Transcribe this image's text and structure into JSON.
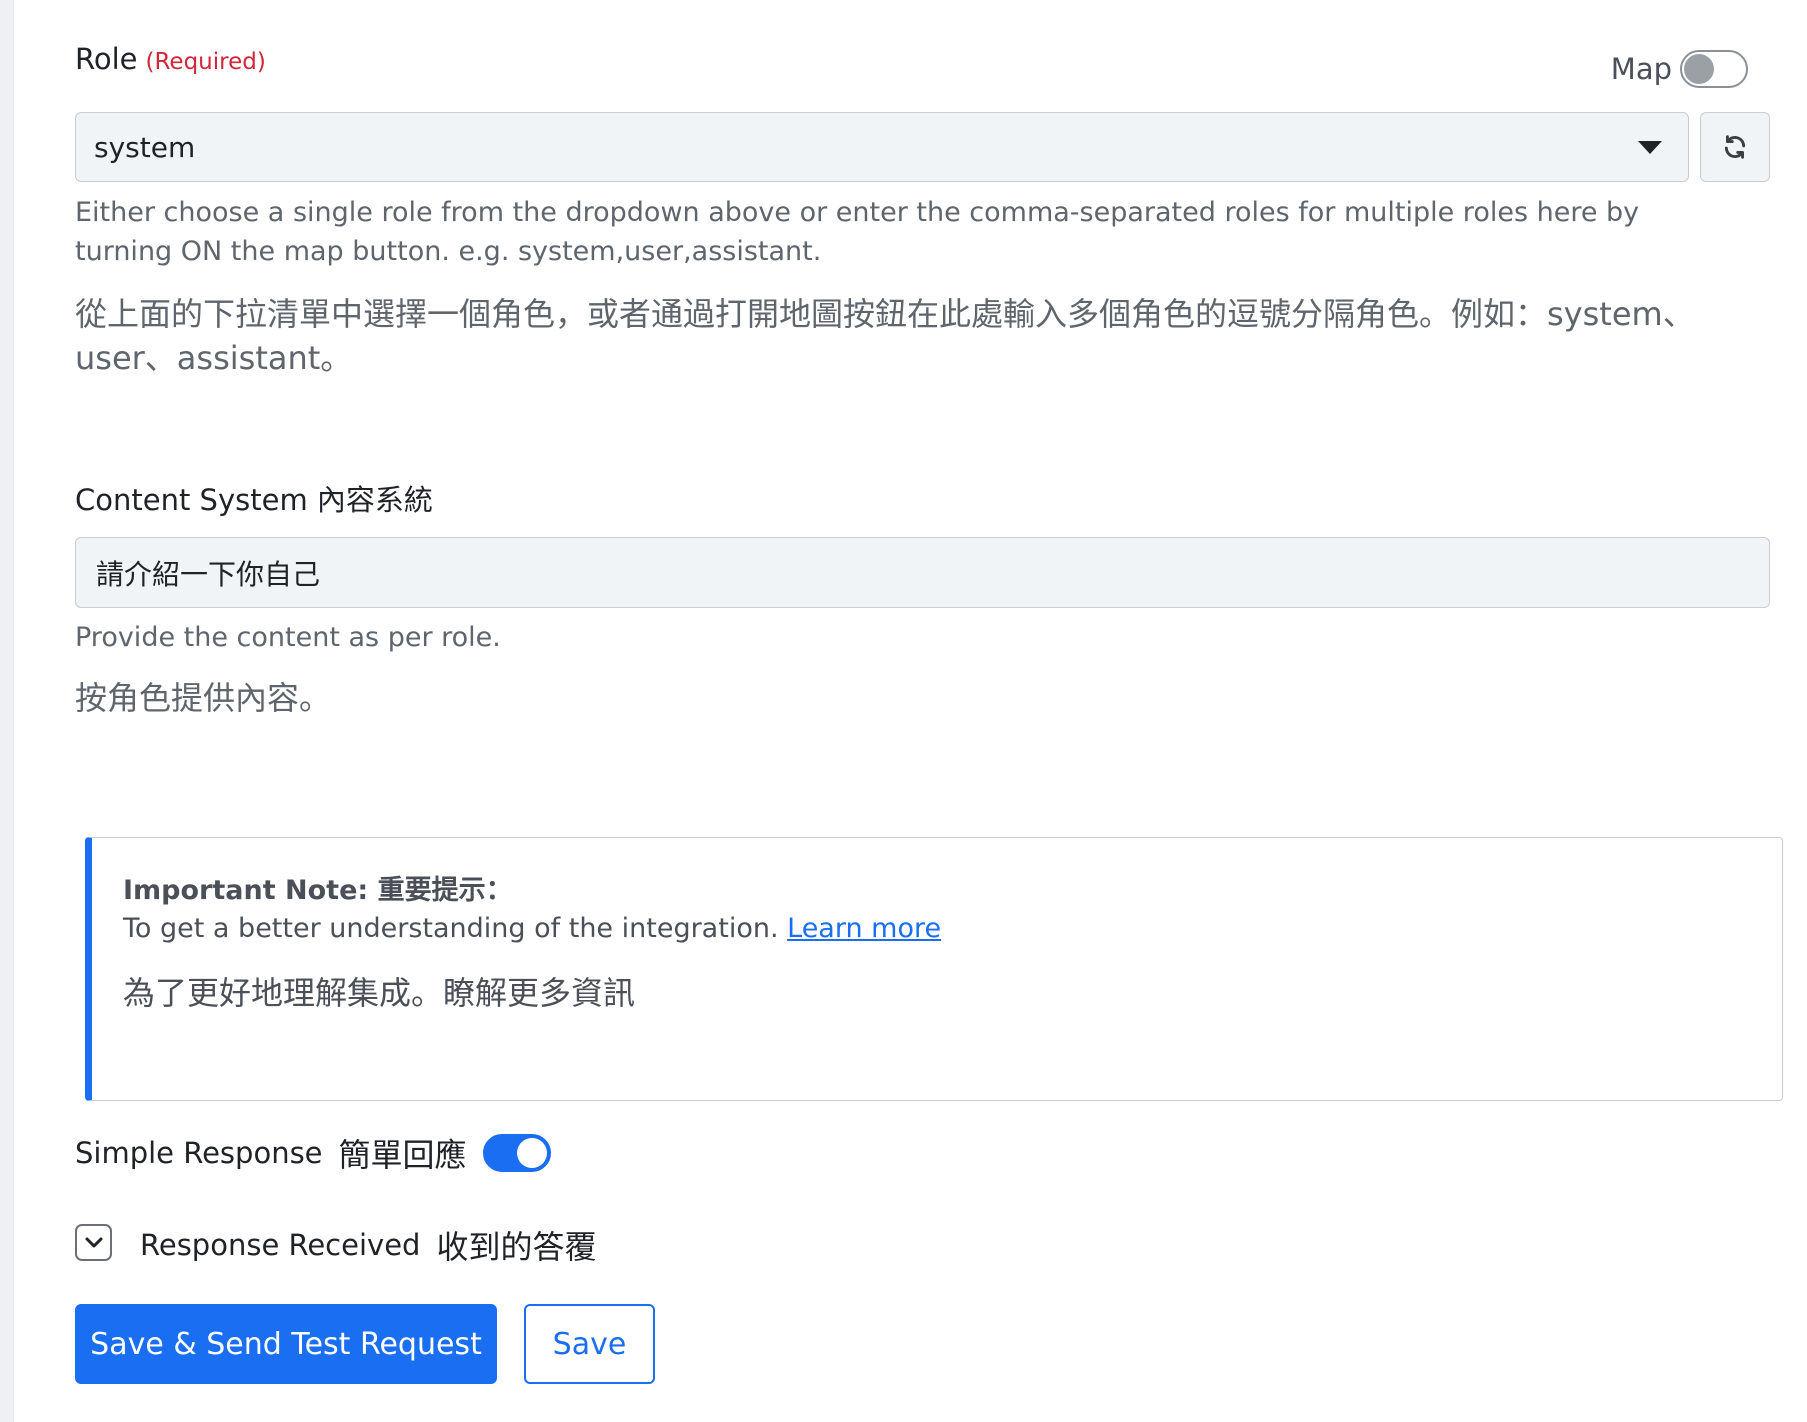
{
  "role": {
    "label": "Role",
    "required_text": "(Required)",
    "map_label": "Map",
    "map_enabled": false,
    "selected_value": "system",
    "help_en": "Either choose a single role from the dropdown above or enter the comma-separated roles for multiple roles here by turning ON the map button. e.g. system,user,assistant.",
    "help_zh": "從上面的下拉清單中選擇一個角色，或者通過打開地圖按鈕在此處輸入多個角色的逗號分隔角色。例如：system、user、assistant。"
  },
  "content": {
    "label": "Content System 內容系統",
    "value": "請介紹一下你自己",
    "help_en": "Provide the content as per role.",
    "help_zh": "按角色提供內容。"
  },
  "note": {
    "title": "Important Note: 重要提示：",
    "text": "To get a better understanding of the integration.",
    "link_text": "Learn more",
    "text_zh": "為了更好地理解集成。瞭解更多資訊"
  },
  "simple_response": {
    "label": "Simple Response",
    "label_zh": "簡單回應",
    "enabled": true
  },
  "response_received": {
    "label": "Response Received",
    "label_zh": "收到的答覆"
  },
  "buttons": {
    "save_send": "Save & Send Test Request",
    "save": "Save"
  },
  "colors": {
    "accent": "#1a6ef2",
    "required": "#d0273a",
    "field_bg": "#f1f4f6"
  }
}
